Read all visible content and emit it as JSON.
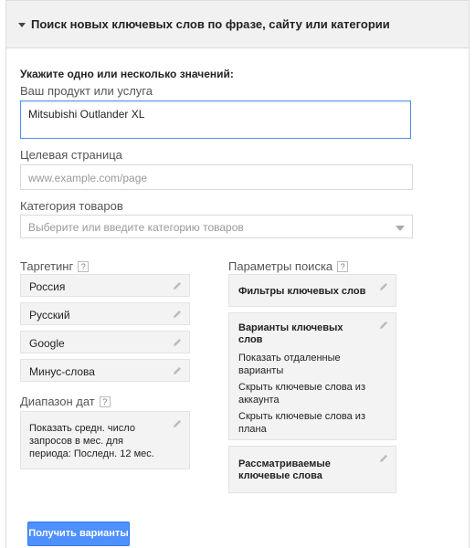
{
  "header": {
    "title": "Поиск новых ключевых слов по фразе, сайту или категории"
  },
  "form": {
    "heading": "Укажите одно или несколько значений:",
    "product_label": "Ваш продукт или услуга",
    "product_value": "Mitsubishi Outlander XL",
    "landing_label": "Целевая страница",
    "landing_placeholder": "www.example.com/page",
    "category_label": "Категория товаров",
    "category_placeholder": "Выберите или введите категорию товаров"
  },
  "targeting": {
    "label": "Таргетинг",
    "help": "?",
    "items": [
      "Россия",
      "Русский",
      "Google",
      "Минус-слова"
    ]
  },
  "date_range": {
    "label": "Диапазон дат",
    "help": "?",
    "text": "Показать средн. число запросов в мес. для периода: Последн. 12 мес."
  },
  "search_params": {
    "label": "Параметры поиска",
    "help": "?",
    "filters_title": "Фильтры ключевых слов",
    "variants_title": "Варианты ключевых слов",
    "variants_options": [
      "Показать отдаленные варианты",
      "Скрыть ключевые слова из аккаунта",
      "Скрыть ключевые слова из плана"
    ],
    "considered_title": "Рассматриваемые ключевые слова"
  },
  "actions": {
    "get_ideas": "Получить варианты"
  },
  "icons": {
    "caret": "caret-down-icon",
    "edit": "pencil-icon",
    "help": "help-icon",
    "dropdown": "dropdown-arrow-icon"
  },
  "colors": {
    "accent": "#4d90fe",
    "focus_border": "#4d90fe",
    "panel_bg": "#f3f3f3"
  }
}
